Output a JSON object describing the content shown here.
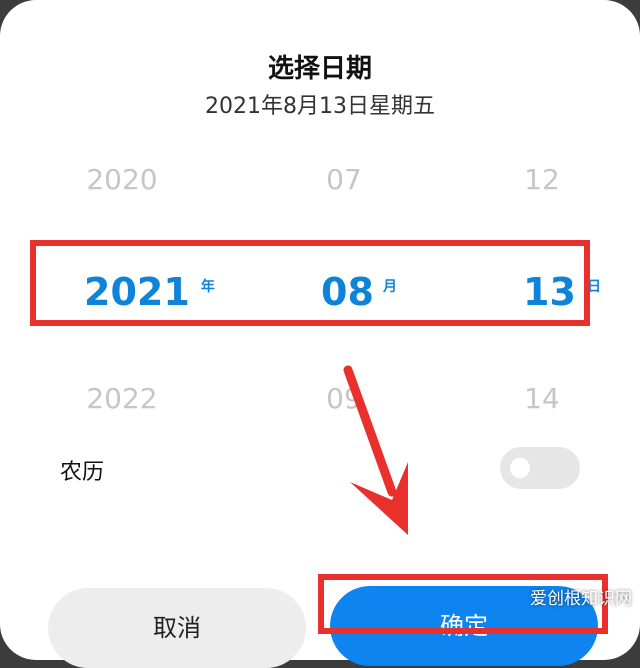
{
  "dialog": {
    "title": "选择日期",
    "subtitle": "2021年8月13日星期五"
  },
  "picker": {
    "year": {
      "prev": "2020",
      "selected": "2021",
      "unit": "年",
      "next": "2022"
    },
    "month": {
      "prev": "07",
      "selected": "08",
      "unit": "月",
      "next": "09"
    },
    "day": {
      "prev": "12",
      "selected": "13",
      "unit": "日",
      "next": "14"
    }
  },
  "lunar": {
    "label": "农历",
    "enabled": false
  },
  "buttons": {
    "cancel_label": "取消",
    "confirm_label": "确定"
  },
  "watermark": "爱创根知识网",
  "colors": {
    "accent": "#0d84d8",
    "annotation_red": "#e9302c",
    "faded_text": "#c6c6c6",
    "confirm_bg": "#0d84ef"
  }
}
